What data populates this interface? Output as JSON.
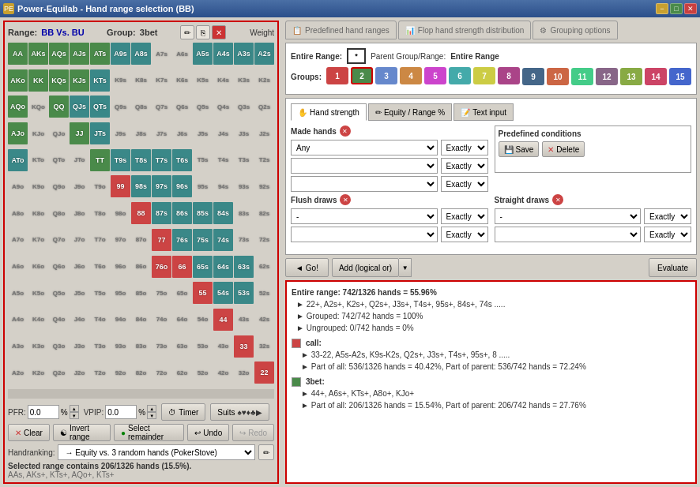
{
  "app": {
    "title": "Power-Equilab - Hand range selection (BB)",
    "titleIcon": "PE"
  },
  "titleBar": {
    "minimize": "−",
    "maximize": "□",
    "close": "✕"
  },
  "leftPanel": {
    "rangeLabel": "Range:",
    "rangeValue": "BB Vs. BU",
    "groupLabel": "Group:",
    "groupValue": "3bet",
    "weightLabel": "Weight"
  },
  "grid": {
    "rows": [
      [
        "AA",
        "AKs",
        "AQs",
        "AJs",
        "ATs",
        "A9s",
        "A8s",
        "A7s",
        "A6s",
        "A5s",
        "A4s",
        "A3s",
        "A2s"
      ],
      [
        "AKo",
        "KK",
        "KQs",
        "KJs",
        "KTs",
        "K9s",
        "K8s",
        "K7s",
        "K6s",
        "K5s",
        "K4s",
        "K3s",
        "K2s"
      ],
      [
        "AQo",
        "KQo",
        "QQ",
        "QJs",
        "QTs",
        "Q9s",
        "Q8s",
        "Q7s",
        "Q6s",
        "Q5s",
        "Q4s",
        "Q3s",
        "Q2s"
      ],
      [
        "AJo",
        "KJo",
        "QJo",
        "JJ",
        "JTs",
        "J9s",
        "J8s",
        "J7s",
        "J6s",
        "J5s",
        "J4s",
        "J3s",
        "J2s"
      ],
      [
        "ATo",
        "KTo",
        "QTo",
        "JTo",
        "TT",
        "T9s",
        "T8s",
        "T7s",
        "T6s",
        "T5s",
        "T4s",
        "T3s",
        "T2s"
      ],
      [
        "A9o",
        "K9o",
        "Q9o",
        "J9o",
        "T9o",
        "99",
        "98s",
        "97s",
        "96s",
        "95s",
        "94s",
        "93s",
        "92s"
      ],
      [
        "A8o",
        "K8o",
        "Q8o",
        "J8o",
        "T8o",
        "98o",
        "88",
        "87s",
        "86s",
        "85s",
        "84s",
        "83s",
        "82s"
      ],
      [
        "A7o",
        "K7o",
        "Q7o",
        "J7o",
        "T7o",
        "97o",
        "87o",
        "77",
        "76s",
        "75s",
        "74s",
        "73s",
        "72s"
      ],
      [
        "A6o",
        "K6o",
        "Q6o",
        "J6o",
        "T6o",
        "96o",
        "86o",
        "76o",
        "66",
        "65s",
        "64s",
        "63s",
        "62s"
      ],
      [
        "A5o",
        "K5o",
        "Q5o",
        "J5o",
        "T5o",
        "95o",
        "85o",
        "75o",
        "65o",
        "55",
        "54s",
        "53s",
        "52s"
      ],
      [
        "A4o",
        "K4o",
        "Q4o",
        "J4o",
        "T4o",
        "94o",
        "84o",
        "74o",
        "64o",
        "54o",
        "44",
        "43s",
        "42s"
      ],
      [
        "A3o",
        "K3o",
        "Q3o",
        "J3o",
        "T3o",
        "93o",
        "83o",
        "73o",
        "63o",
        "53o",
        "43o",
        "33",
        "32s"
      ],
      [
        "A2o",
        "K2o",
        "Q2o",
        "J2o",
        "T2o",
        "92o",
        "82o",
        "72o",
        "62o",
        "52o",
        "42o",
        "32o",
        "22"
      ]
    ],
    "colors": {
      "AA": "c-green",
      "AKs": "c-green",
      "AQs": "c-green",
      "AJs": "c-green",
      "ATs": "c-green",
      "A9s": "c-teal",
      "A8s": "c-teal",
      "A7s": "c-empty",
      "A6s": "c-empty",
      "A5s": "c-teal",
      "A4s": "c-teal",
      "A3s": "c-teal",
      "A2s": "c-teal",
      "AKo": "c-green",
      "KK": "c-green",
      "KQs": "c-green",
      "KJs": "c-green",
      "KTs": "c-teal",
      "K9s": "c-empty",
      "K8s": "c-empty",
      "K7s": "c-empty",
      "K6s": "c-empty",
      "K5s": "c-empty",
      "K4s": "c-empty",
      "K3s": "c-empty",
      "K2s": "c-empty",
      "AQo": "c-green",
      "KQo": "c-empty",
      "QQ": "c-green",
      "QJs": "c-teal",
      "QTs": "c-teal",
      "Q9s": "c-empty",
      "Q8s": "c-empty",
      "Q7s": "c-empty",
      "Q6s": "c-empty",
      "Q5s": "c-empty",
      "Q4s": "c-empty",
      "Q3s": "c-empty",
      "Q2s": "c-empty",
      "AJo": "c-green",
      "KJo": "c-empty",
      "QJo": "c-empty",
      "JJ": "c-green",
      "JTs": "c-teal",
      "J9s": "c-empty",
      "J8s": "c-empty",
      "J7s": "c-empty",
      "J6s": "c-empty",
      "J5s": "c-empty",
      "J4s": "c-empty",
      "J3s": "c-empty",
      "J2s": "c-empty",
      "ATo": "c-teal",
      "KTo": "c-empty",
      "QTo": "c-empty",
      "JTo": "c-empty",
      "TT": "c-green",
      "T9s": "c-teal",
      "T8s": "c-teal",
      "T7s": "c-teal",
      "T6s": "c-teal",
      "T5s": "c-empty",
      "T4s": "c-empty",
      "T3s": "c-empty",
      "T2s": "c-empty",
      "A9o": "c-empty",
      "K9o": "c-empty",
      "Q9o": "c-empty",
      "J9o": "c-empty",
      "T9o": "c-empty",
      "99": "c-red",
      "98s": "c-teal",
      "97s": "c-teal",
      "96s": "c-teal",
      "95s": "c-empty",
      "94s": "c-empty",
      "93s": "c-empty",
      "92s": "c-empty",
      "A8o": "c-empty",
      "K8o": "c-empty",
      "Q8o": "c-empty",
      "J8o": "c-empty",
      "T8o": "c-empty",
      "98o": "c-empty",
      "88": "c-red",
      "87s": "c-teal",
      "86s": "c-teal",
      "85s": "c-teal",
      "84s": "c-teal",
      "83s": "c-empty",
      "82s": "c-empty",
      "A7o": "c-empty",
      "K7o": "c-empty",
      "Q7o": "c-empty",
      "J7o": "c-empty",
      "T7o": "c-empty",
      "97o": "c-empty",
      "87o": "c-empty",
      "77": "c-red",
      "76s": "c-teal",
      "75s": "c-teal",
      "74s": "c-teal",
      "73s": "c-empty",
      "72s": "c-empty",
      "A6o": "c-empty",
      "K6o": "c-empty",
      "Q6o": "c-empty",
      "J6o": "c-empty",
      "T6o": "c-empty",
      "96o": "c-empty",
      "86o": "c-empty",
      "76o": "c-red",
      "66": "c-red",
      "65s": "c-teal",
      "64s": "c-teal",
      "63s": "c-teal",
      "62s": "c-empty",
      "A5o": "c-empty",
      "K5o": "c-empty",
      "Q5o": "c-empty",
      "J5o": "c-empty",
      "T5o": "c-empty",
      "95o": "c-empty",
      "85o": "c-empty",
      "75o": "c-empty",
      "65o": "c-empty",
      "55": "c-red",
      "54s": "c-teal",
      "53s": "c-teal",
      "52s": "c-empty",
      "A4o": "c-empty",
      "K4o": "c-empty",
      "Q4o": "c-empty",
      "J4o": "c-empty",
      "T4o": "c-empty",
      "94o": "c-empty",
      "84o": "c-empty",
      "74o": "c-empty",
      "64o": "c-empty",
      "54o": "c-empty",
      "44": "c-red",
      "43s": "c-empty",
      "42s": "c-empty",
      "A3o": "c-empty",
      "K3o": "c-empty",
      "Q3o": "c-empty",
      "J3o": "c-empty",
      "T3o": "c-empty",
      "93o": "c-empty",
      "83o": "c-empty",
      "73o": "c-empty",
      "63o": "c-empty",
      "53o": "c-empty",
      "43o": "c-empty",
      "33": "c-red",
      "32s": "c-empty",
      "A2o": "c-empty",
      "K2o": "c-empty",
      "Q2o": "c-empty",
      "J2o": "c-empty",
      "T2o": "c-empty",
      "92o": "c-empty",
      "82o": "c-empty",
      "72o": "c-empty",
      "62o": "c-empty",
      "52o": "c-empty",
      "42o": "c-empty",
      "32o": "c-empty",
      "22": "c-red"
    }
  },
  "bottomControls": {
    "pfrLabel": "PFR:",
    "pfrValue": "0.0",
    "pctSign": "%",
    "vpipLabel": "VPIP:",
    "vpipValue": "0.0",
    "timerLabel": "Timer",
    "suitsLabel": "Suits",
    "suitsSymbols": "♠♥♦♣▶"
  },
  "actionButtons": {
    "clear": "Clear",
    "invertRange": "Invert range",
    "selectRemainder": "Select remainder",
    "undo": "Undo",
    "redo": "Redo"
  },
  "handranking": {
    "label": "Handranking:",
    "value": "→ Equity vs. 3 random hands (PokerStove)"
  },
  "selectedRange": {
    "text": "Selected range contains 206/1326 hands (15.5%).",
    "sub": "AAs, AKs+, KTs+, AQo+, KTs+"
  },
  "rightPanel": {
    "tabs": [
      {
        "label": "Predefined hand ranges",
        "active": false,
        "icon": "📋"
      },
      {
        "label": "Flop hand strength distribution",
        "active": false,
        "icon": "📊"
      },
      {
        "label": "Grouping options",
        "active": false,
        "icon": "⚙"
      }
    ]
  },
  "rangeGroups": {
    "entireRangeLabel": "Entire Range:",
    "starLabel": "*",
    "parentGroupLabel": "Parent Group/Range:",
    "parentGroupValue": "Entire Range",
    "groupsLabel": "Groups:",
    "groups": [
      {
        "num": "1",
        "color": "#cc4444",
        "selected": false
      },
      {
        "num": "2",
        "color": "#4a8a4a",
        "selected": true
      },
      {
        "num": "3",
        "color": "#6688cc",
        "selected": false
      },
      {
        "num": "4",
        "color": "#cc8844",
        "selected": false
      },
      {
        "num": "5",
        "color": "#cc44cc",
        "selected": false
      },
      {
        "num": "6",
        "color": "#44aaaa",
        "selected": false
      },
      {
        "num": "7",
        "color": "#cccc44",
        "selected": false
      },
      {
        "num": "8",
        "color": "#aa4488",
        "selected": false
      },
      {
        "num": "9",
        "color": "#446688",
        "selected": false
      },
      {
        "num": "10",
        "color": "#cc6644",
        "selected": false
      },
      {
        "num": "11",
        "color": "#44cc88",
        "selected": false
      },
      {
        "num": "12",
        "color": "#886688",
        "selected": false
      },
      {
        "num": "13",
        "color": "#88aa44",
        "selected": false
      },
      {
        "num": "14",
        "color": "#cc4466",
        "selected": false
      },
      {
        "num": "15",
        "color": "#4466cc",
        "selected": false
      }
    ]
  },
  "handStrength": {
    "tabs": [
      "Hand strength",
      "Equity / Range %",
      "Text input"
    ],
    "activeTab": 0,
    "madeHandsLabel": "Made hands",
    "row1": {
      "select": "Any",
      "exactly": "Exactly"
    },
    "row2": {
      "select": "",
      "exactly": "Exactly"
    },
    "row3": {
      "select": "",
      "exactly": "Exactly"
    },
    "predefinedLabel": "Predefined conditions",
    "saveLabel": "Save",
    "deleteLabel": "Delete",
    "flushDrawsLabel": "Flush draws",
    "straightDrawsLabel": "Straight draws",
    "fd_row1": {
      "select": "-",
      "exactly": "Exactly"
    },
    "fd_row2": {
      "select": "",
      "exactly": "Exactly"
    },
    "sd_row1": {
      "select": "-",
      "exactly": "Exactly"
    },
    "sd_row2": {
      "select": "",
      "exactly": "Exactly"
    }
  },
  "bottomActions": {
    "goLabel": "◄ Go!",
    "addLabel": "Add (logical or)",
    "evaluateLabel": "Evaluate"
  },
  "results": {
    "line1": "Entire range: 742/1326 hands = 55.96%",
    "line2": "► 22+, A2s+, K2s+, Q2s+, J3s+, T4s+, 95s+, 84s+, 74s .....",
    "line3": "► Grouped: 742/742 hands = 100%",
    "line4": "► Ungrouped: 0/742 hands = 0%",
    "callLabel": "call:",
    "callColor": "#cc4444",
    "callLine1": "► 33-22, A5s-A2s, K9s-K2s, Q2s+, J3s+, T4s+, 95s+, 8 .....",
    "callLine2": "► Part of all: 536/1326 hands = 40.42%, Part of parent: 536/742 hands = 72.24%",
    "tbetLabel": "3bet:",
    "tbetColor": "#4a8a4a",
    "tbetLine1": "► 44+, A6s+, KTs+, A8o+, KJo+",
    "tbetLine2": "► Part of all: 206/1326 hands = 15.54%, Part of parent: 206/742 hands = 27.76%"
  }
}
